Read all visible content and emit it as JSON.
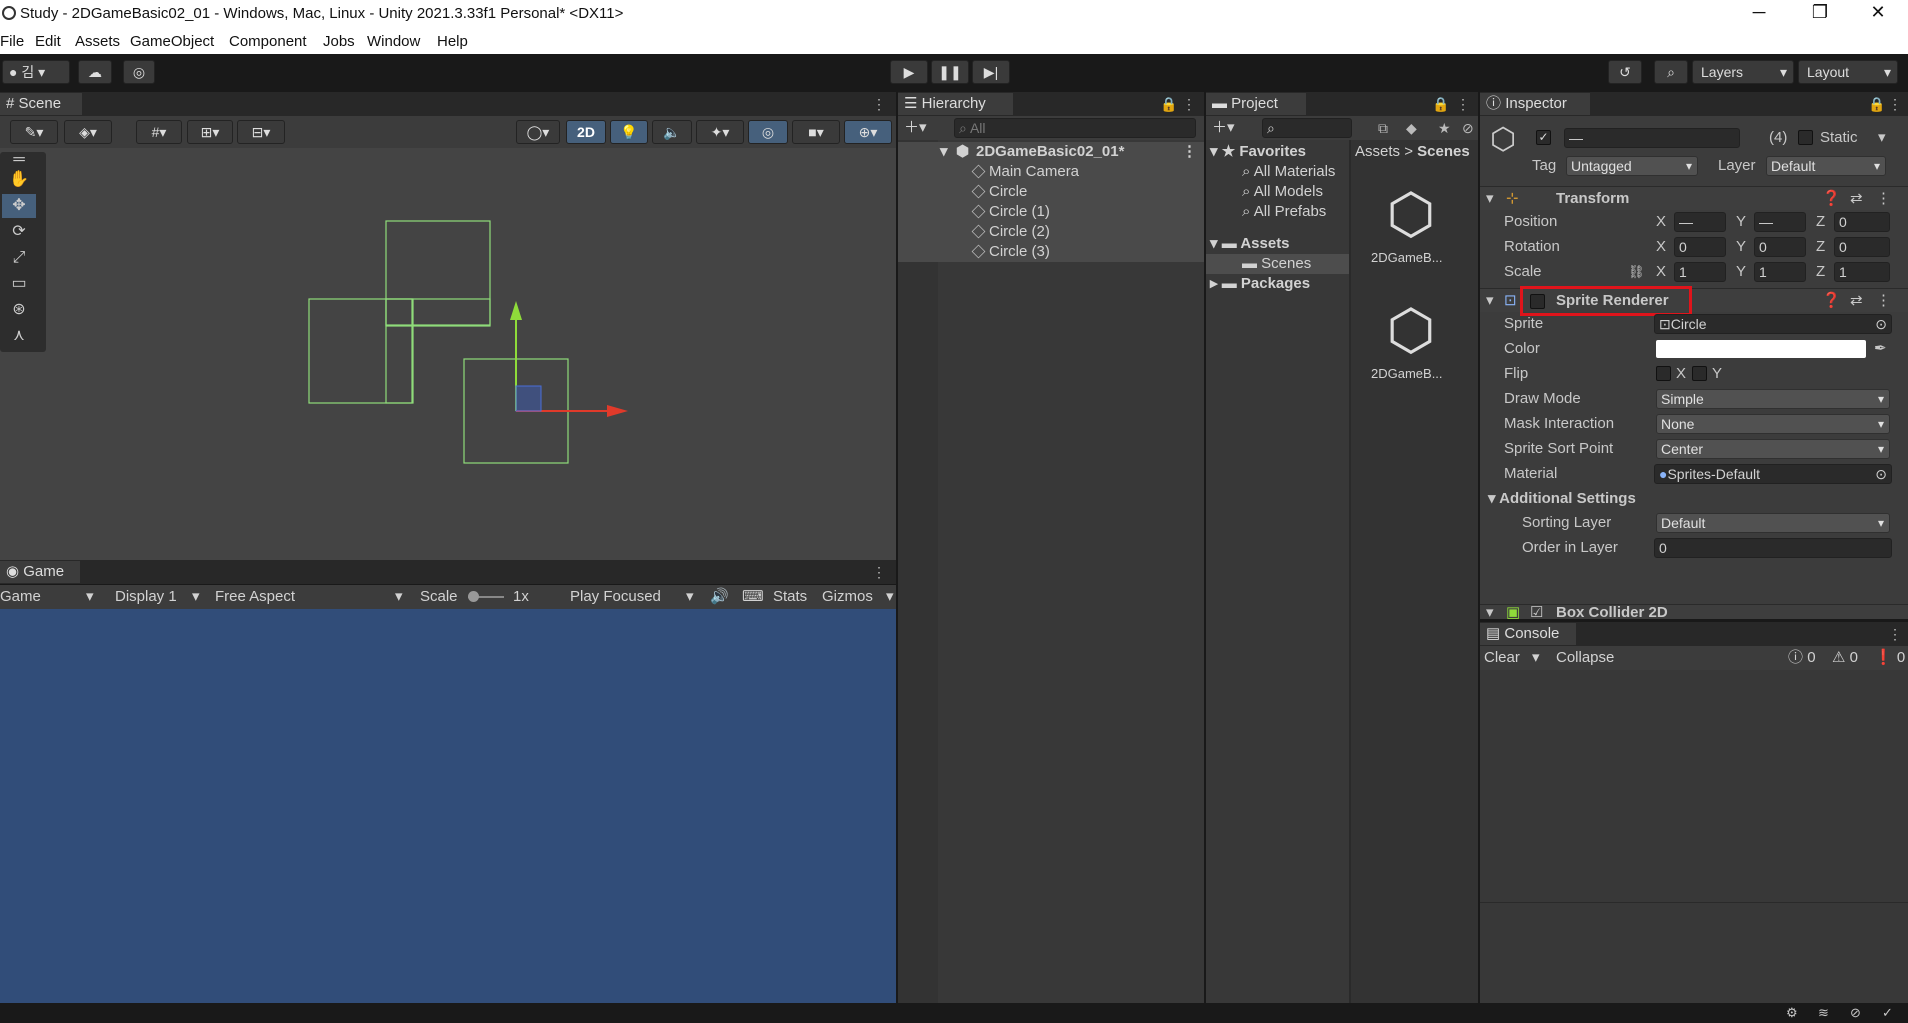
{
  "window": {
    "title": "Study - 2DGameBasic02_01 - Windows, Mac, Linux - Unity 2021.3.33f1 Personal* <DX11>",
    "minimize": "─",
    "maximize": "❐",
    "close": "✕"
  },
  "menu": [
    "File",
    "Edit",
    "Assets",
    "GameObject",
    "Component",
    "Jobs",
    "Window",
    "Help"
  ],
  "toolbar": {
    "account": "김",
    "layers": "Layers",
    "layout": "Layout"
  },
  "scene": {
    "tab": "Scene",
    "mode2d": "2D"
  },
  "game": {
    "tab": "Game",
    "game_dropdown": "Game",
    "display": "Display 1",
    "aspect": "Free Aspect",
    "scale_label": "Scale",
    "scale_value": "1x",
    "play_mode": "Play Focused",
    "stats": "Stats",
    "gizmos": "Gizmos"
  },
  "hierarchy": {
    "tab": "Hierarchy",
    "search_placeholder": "All",
    "scene_name": "2DGameBasic02_01*",
    "items": [
      "Main Camera",
      "Circle",
      "Circle (1)",
      "Circle (2)",
      "Circle (3)"
    ]
  },
  "project": {
    "tab": "Project",
    "favorites": "Favorites",
    "fav_items": [
      "All Materials",
      "All Models",
      "All Prefabs"
    ],
    "assets": "Assets",
    "scenes": "Scenes",
    "packages": "Packages",
    "breadcrumb_root": "Assets",
    "breadcrumb_sep": ">",
    "breadcrumb_current": "Scenes",
    "files": [
      "2DGameB...",
      "2DGameB..."
    ]
  },
  "inspector": {
    "tab": "Inspector",
    "name_value": "—",
    "count": "(4)",
    "static": "Static",
    "tag_label": "Tag",
    "tag_value": "Untagged",
    "layer_label": "Layer",
    "layer_value": "Default",
    "transform": {
      "title": "Transform",
      "position": "Position",
      "rotation": "Rotation",
      "scale": "Scale",
      "px": "—",
      "py": "—",
      "pz": "0",
      "rx": "0",
      "ry": "0",
      "rz": "0",
      "sx": "1",
      "sy": "1",
      "sz": "1",
      "x": "X",
      "y": "Y",
      "z": "Z"
    },
    "sprite_renderer": {
      "title": "Sprite Renderer",
      "sprite_label": "Sprite",
      "sprite_value": "Circle",
      "color_label": "Color",
      "flip_label": "Flip",
      "flip_x": "X",
      "flip_y": "Y",
      "draw_mode_label": "Draw Mode",
      "draw_mode": "Simple",
      "mask_label": "Mask Interaction",
      "mask": "None",
      "sort_point_label": "Sprite Sort Point",
      "sort_point": "Center",
      "material_label": "Material",
      "material": "Sprites-Default",
      "additional": "Additional Settings",
      "sorting_layer_label": "Sorting Layer",
      "sorting_layer": "Default",
      "order_label": "Order in Layer",
      "order": "0"
    },
    "box_collider": {
      "title": "Box Collider 2D"
    }
  },
  "console": {
    "tab": "Console",
    "clear": "Clear",
    "collapse": "Collapse",
    "logs": "0",
    "warnings": "0",
    "errors": "0"
  },
  "colors": {
    "highlight": "#e0141b",
    "game_bg": "#314d79",
    "selection": "#46607c"
  }
}
